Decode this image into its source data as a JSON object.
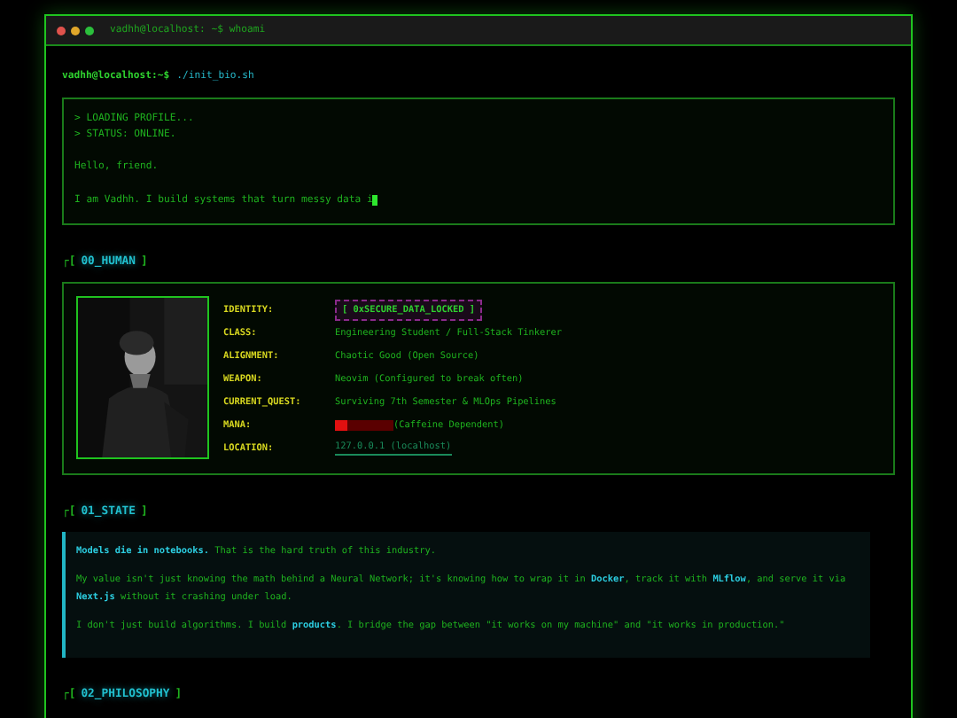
{
  "window": {
    "title": "vadhh@localhost: ~$ whoami"
  },
  "prompt": {
    "user": "vadhh@localhost:~$",
    "command": "./init_bio.sh"
  },
  "boot_log": {
    "blocks": [
      [
        "> LOADING PROFILE...",
        "> STATUS: ONLINE."
      ],
      [
        "Hello, friend."
      ],
      [
        "I am Vadhh. I build systems that turn messy data i"
      ]
    ],
    "cursor": true
  },
  "sections": [
    {
      "prefix": "┌[",
      "title": "00_HUMAN",
      "suffix": "]",
      "kind": "profile",
      "fields": [
        {
          "label": "IDENTITY:",
          "value": "[ 0xSECURE_DATA_LOCKED ]",
          "kind": "locked"
        },
        {
          "label": "CLASS:",
          "value": "Engineering Student / Full-Stack Tinkerer",
          "kind": "text"
        },
        {
          "label": "ALIGNMENT:",
          "value": "Chaotic Good (Open Source)",
          "kind": "text"
        },
        {
          "label": "WEAPON:",
          "value": "Neovim (Configured to break often)",
          "kind": "text"
        },
        {
          "label": "CURRENT_QUEST:",
          "value": "Surviving 7th Semester & MLOps Pipelines",
          "kind": "text"
        },
        {
          "label": "MANA:",
          "value": "(Caffeine Dependent)",
          "kind": "meter",
          "level": 0.2
        },
        {
          "label": "LOCATION:",
          "value": "127.0.0.1 (localhost)",
          "kind": "link"
        }
      ]
    },
    {
      "prefix": "┌[",
      "title": "01_STATE",
      "suffix": "]",
      "kind": "quote",
      "paragraphs": [
        "**Models die in notebooks.** That is the hard truth of this industry.",
        "My value isn't just knowing the math behind a Neural Network; it's knowing how to wrap it in **Docker**, track it with **MLflow**, and serve it via **Next.js** without it crashing under load.",
        "I don't just build algorithms. I build **products**. I bridge the gap between \"it works on my machine\" and \"it works in production.\""
      ]
    },
    {
      "prefix": "┌[",
      "title": "02_PHILOSOPHY",
      "suffix": "]",
      "kind": "heading"
    }
  ]
}
